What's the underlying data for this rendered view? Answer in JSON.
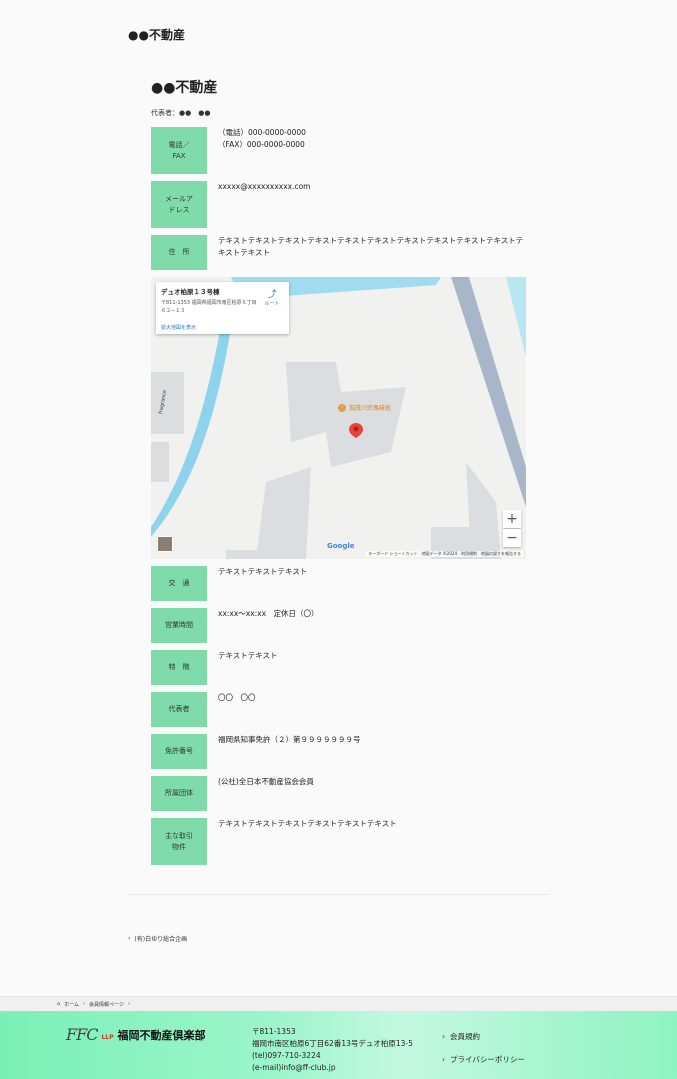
{
  "page_title": "●●不動産",
  "company_name": "●●不動産",
  "representative_line": "代表者：●●　●●",
  "top_rows": [
    {
      "label": "電話／\nFAX",
      "value": "（電話）000-0000-0000\n（FAX）000-0000-0000"
    },
    {
      "label": "メールア\nドレス",
      "value": "xxxxx@xxxxxxxxxx.com"
    },
    {
      "label": "住　所",
      "value": "テキストテキストテキストテキストテキストテキストテキストテキストテキストテキストテキストテキスト"
    }
  ],
  "map": {
    "place_name": "デュオ柏原１３号棟",
    "place_address": "〒811-1353 福岡県福岡市南区柏原６丁目６２−１３",
    "enlarge_link": "拡大地図を表示",
    "route_label": "ルート",
    "poi_label": "加茂川宗馬味処",
    "road_label": "fragrance",
    "google_label": "Google",
    "attribution": "キーボード ショートカット　地図データ ©2024　利用規約　地図の誤りを報告する",
    "zoom_in": "+",
    "zoom_out": "−"
  },
  "bottom_rows": [
    {
      "label": "交　通",
      "value": "テキストテキストテキスト"
    },
    {
      "label": "営業時間",
      "value": "xx:xx〜xx:xx　定休日（〇）"
    },
    {
      "label": "特　徴",
      "value": "テキストテキスト"
    },
    {
      "label": "代表者",
      "value": "〇〇　〇〇"
    },
    {
      "label": "免許番号",
      "value": "福岡県知事免許（２）第９９９９９９９号"
    },
    {
      "label": "所属団体",
      "value": "(公社)全日本不動産協会会員"
    },
    {
      "label": "主な取引\n物件",
      "value": "テキストテキストテキストテキストテキストテキスト"
    }
  ],
  "back_link": "(有)白ゆり総合企画",
  "breadcrumb": [
    "ホーム",
    "会員情報ページ"
  ],
  "footer": {
    "logo_ffc": "FFC",
    "logo_llp": "LLP",
    "org_name": "福岡不動産倶楽部",
    "address_lines": [
      "〒811-1353",
      "福岡市南区柏原6丁目62番13号デュオ柏原13-5",
      "(tel)097-710-3224",
      "(e-mail)info@ff-club.jp"
    ],
    "links": [
      "会員規約",
      "プライバシーポリシー"
    ]
  }
}
